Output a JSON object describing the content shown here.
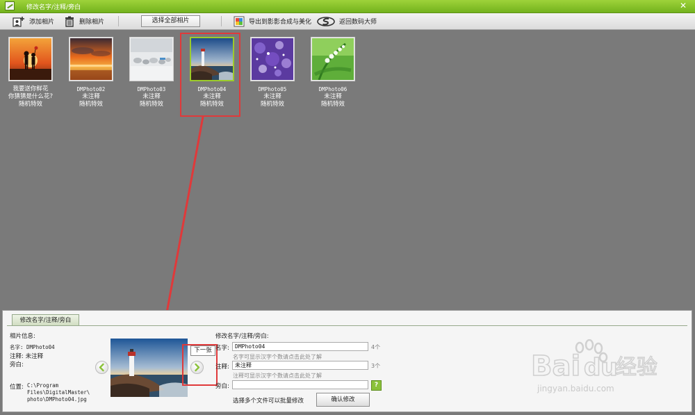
{
  "window": {
    "title": "修改名字/注释/旁白",
    "close_glyph": "✕"
  },
  "toolbar": {
    "add_photo": "添加相片",
    "delete_photo": "删除相片",
    "select_all": "选择全部相片",
    "export": "导出到影影合成与美化",
    "back": "返回数码大师"
  },
  "thumbnails": [
    {
      "line1": "我要送你鲜花",
      "line2": "你猜猜是什么花?",
      "line3": "随机特效",
      "image": "sunset-couple",
      "selected": false
    },
    {
      "line1": "DMPhoto02",
      "line2": "未注释",
      "line3": "随机特效",
      "image": "sunset-clouds",
      "selected": false
    },
    {
      "line1": "DMPhoto03",
      "line2": "未注释",
      "line3": "随机特效",
      "image": "gray-stones",
      "selected": false
    },
    {
      "line1": "DMPhoto04",
      "line2": "未注释",
      "line3": "随机特效",
      "image": "lighthouse",
      "selected": true
    },
    {
      "line1": "DMPhoto05",
      "line2": "未注释",
      "line3": "随机特效",
      "image": "purple-bokeh",
      "selected": false
    },
    {
      "line1": "DMPhoto06",
      "line2": "未注释",
      "line3": "随机特效",
      "image": "lily-of-the-valley",
      "selected": false
    }
  ],
  "panel": {
    "tab": "修改名字/注释/旁白",
    "info_title": "相片信息:",
    "name_line": "名字: DMPhoto04",
    "note_line": "注释: 未注释",
    "narration_line": "旁白:",
    "location_label": "位置:",
    "location_path": [
      "C:\\Program",
      "Files\\DigitalMaster\\",
      "photo\\DMPhoto04.jpg"
    ],
    "tooltip_next": "下一张",
    "edit_title": "修改名字/注释/旁白:",
    "name_label": "名字:",
    "name_value": "DMPhoto04",
    "name_count": "4个",
    "name_hint": "名字可显示汉字个数请点击此处了解",
    "note_label": "注释:",
    "note_value": "未注释",
    "note_count": "3个",
    "note_hint": "注释可显示汉字个数请点击此处了解",
    "narration_label": "旁白:",
    "narration_value": "",
    "help_glyph": "?",
    "batch_hint": "选择多个文件可以批量修改",
    "confirm": "确认修改"
  },
  "watermark": {
    "logo_left": "Bai",
    "logo_right": "du",
    "logo_cn": "经验",
    "url": "jingyan.baidu.com"
  },
  "colors": {
    "accent_green": "#8bc23a",
    "annotation_red": "#e0393a",
    "canvas_gray": "#7a7a7a"
  }
}
